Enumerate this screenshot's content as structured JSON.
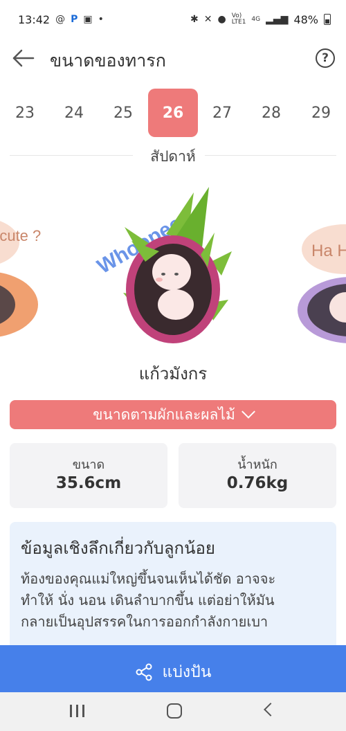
{
  "status_bar": {
    "time": "13:42",
    "battery": "48%",
    "network": "4G"
  },
  "header": {
    "title": "ขนาดของทารก",
    "help_label": "?"
  },
  "weeks": {
    "items": [
      "23",
      "24",
      "25",
      "26",
      "27",
      "28",
      "29"
    ],
    "selected": "26",
    "unit_label": "สัปดาห์"
  },
  "fruit": {
    "name": "แก้วมังกร",
    "logo_text": "Whoopee",
    "left_bubble_text": "Am I cute ?",
    "right_bubble_text": "Ha Ha"
  },
  "category": {
    "label": "ขนาดตามผักและผลไม้"
  },
  "stats": {
    "size_label": "ขนาด",
    "size_value": "35.6cm",
    "weight_label": "น้ำหนัก",
    "weight_value": "0.76kg"
  },
  "insight": {
    "title": "ข้อมูลเชิงลึกเกี่ยวกับลูกน้อย",
    "lines": [
      "ท้องของคุณแม่ใหญ่ขึ้นจนเห็นได้ชัด อาจจะ",
      "ทำให้ นั่ง นอน เดินลำบากขึ้น แต่อย่าให้มัน",
      "กลายเป็นอุปสรรคในการออกกำลังกายเบา"
    ]
  },
  "share": {
    "label": "แบ่งปัน"
  },
  "colors": {
    "accent": "#ee7a7a",
    "share_blue": "#4680ea",
    "insight_bg": "#eaf2fc",
    "card_bg": "#f3f3f5"
  }
}
